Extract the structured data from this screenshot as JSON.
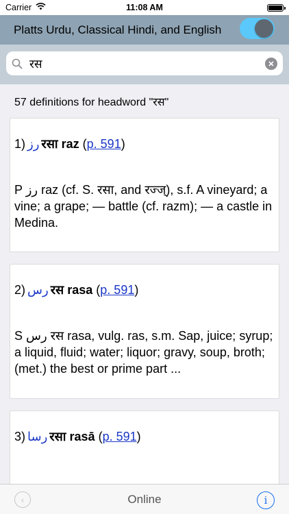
{
  "status": {
    "carrier": "Carrier",
    "time": "11:08 AM"
  },
  "nav": {
    "title": "Platts Urdu, Classical Hindi, and English"
  },
  "search": {
    "value": "रस"
  },
  "results": {
    "count_text": "57 definitions for headword \"रस\""
  },
  "entries": [
    {
      "num": "1)",
      "urdu": "رز",
      "hindi": "रसा",
      "roman": "raz",
      "page_open": "(",
      "page_link": "p. 591",
      "page_close": ")",
      "body": "P رز raz (cf. S. रसा, and रज्ज्), s.f. A vineyard; a vine; a grape; — battle (cf. razm); — a castle in Medina."
    },
    {
      "num": "2)",
      "urdu": "رس",
      "hindi": "रस",
      "roman": "rasa",
      "page_open": "(",
      "page_link": "p. 591",
      "page_close": ")",
      "body": "S رس रस rasa, vulg. ras, s.m. Sap, juice; syrup; a liquid, fluid; water; liquor; gravy, soup, broth; (met.) the best or prime part ..."
    },
    {
      "num": "3)",
      "urdu": "رسا",
      "hindi": "रसा",
      "roman": "rasā",
      "page_open": "(",
      "page_link": "p. 591",
      "page_close": ")"
    }
  ],
  "toolbar": {
    "center": "Online",
    "info_glyph": "i",
    "back_glyph": "‹"
  },
  "colors": {
    "nav": "#8ea3b3",
    "search_bg": "#c3ced6",
    "toggle_on": "#5ac8fa",
    "link": "#1a37c6",
    "info": "#1a6ef0"
  }
}
